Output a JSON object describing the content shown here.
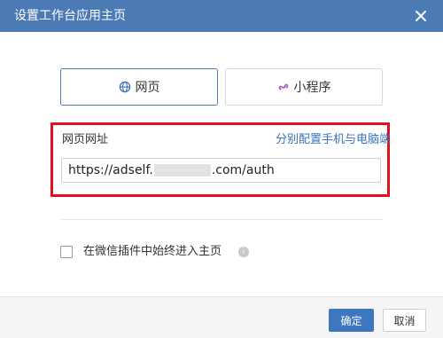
{
  "dialog": {
    "title": "设置工作台应用主页",
    "close_icon": "close-icon"
  },
  "tabs": [
    {
      "label": "网页",
      "icon": "globe-icon",
      "active": true
    },
    {
      "label": "小程序",
      "icon": "mini-program-icon",
      "active": false
    }
  ],
  "url_section": {
    "label": "网页网址",
    "configure_link": "分别配置手机与电脑端",
    "url_prefix": "https://adself.",
    "url_suffix": ".com/auth"
  },
  "option": {
    "checked": false,
    "label": "在微信插件中始终进入主页",
    "info_icon": "info-icon"
  },
  "footer": {
    "ok_label": "确定",
    "cancel_label": "取消"
  },
  "colors": {
    "header": "#4b7ab5",
    "highlight_border": "#e0101c",
    "link": "#3a71b7",
    "primary_button": "#3f77be",
    "mini_program_icon": "#9b59d0"
  }
}
